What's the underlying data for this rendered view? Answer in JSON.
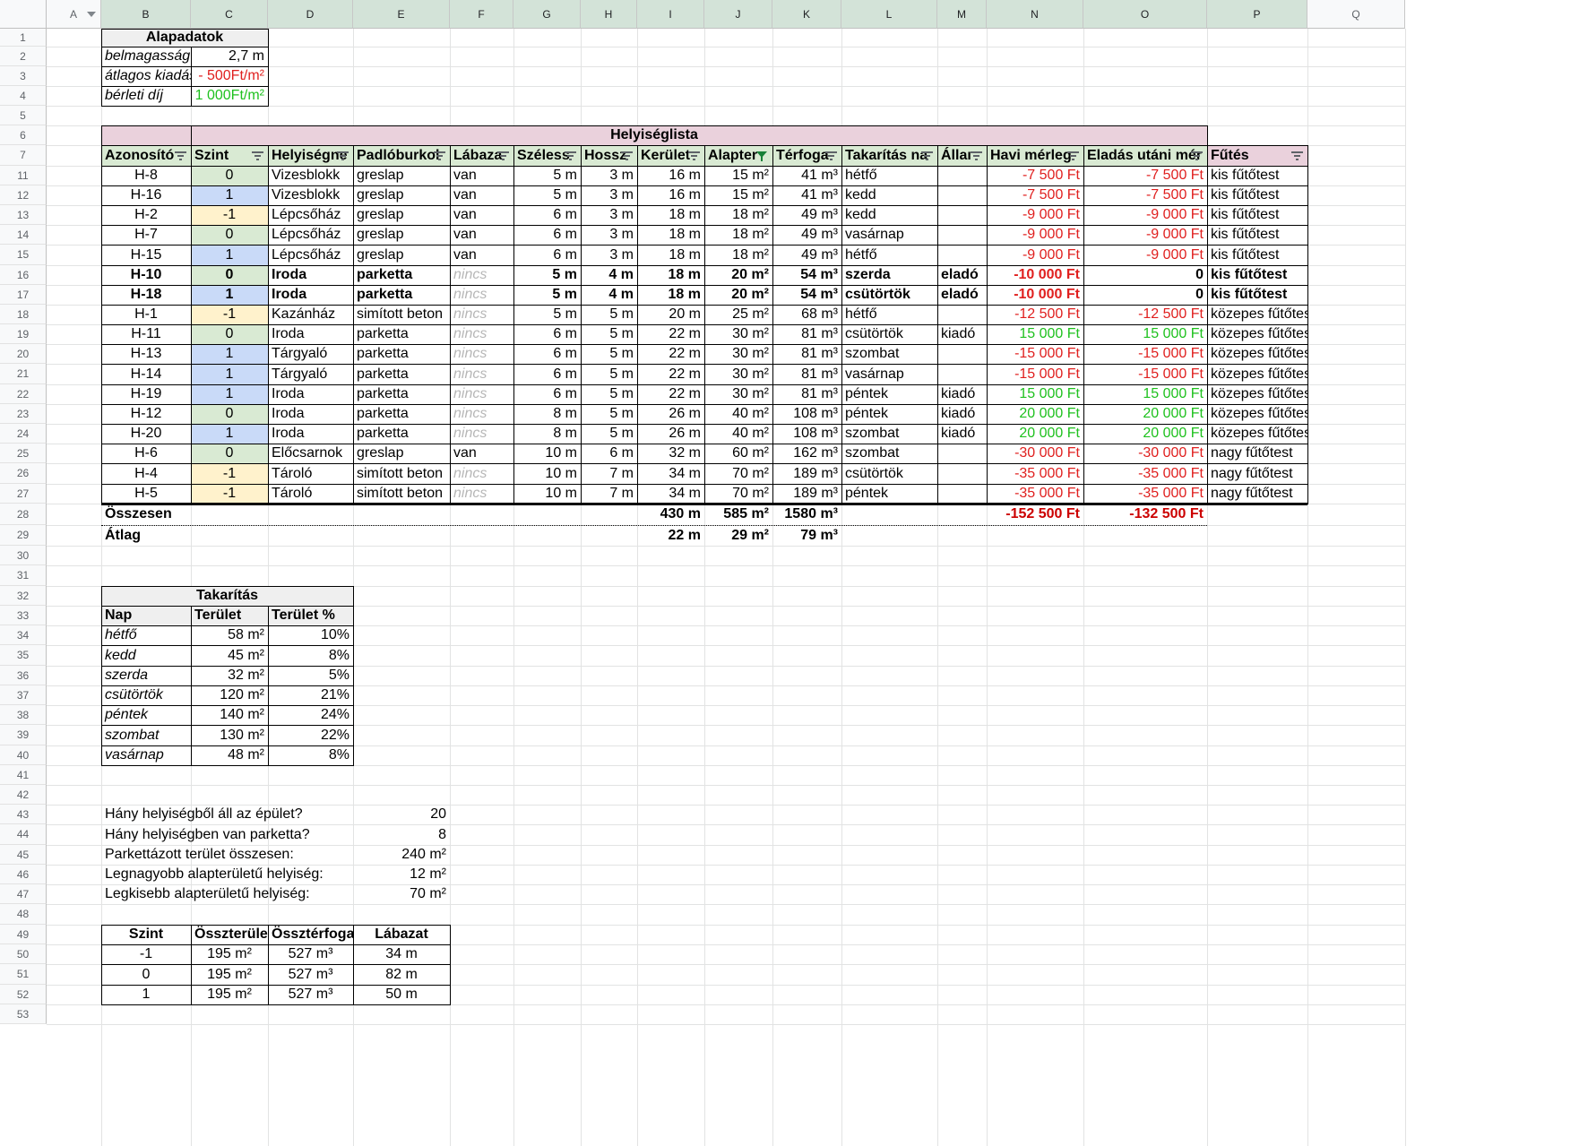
{
  "columns": [
    "A",
    "B",
    "C",
    "D",
    "E",
    "F",
    "G",
    "H",
    "I",
    "J",
    "K",
    "L",
    "M",
    "N",
    "O",
    "P",
    "Q"
  ],
  "rows": [
    1,
    2,
    3,
    4,
    5,
    6,
    7,
    11,
    12,
    13,
    14,
    15,
    16,
    17,
    18,
    19,
    20,
    21,
    22,
    23,
    24,
    25,
    26,
    27,
    28,
    29,
    30,
    31,
    32,
    33,
    34,
    35,
    36,
    37,
    38,
    39,
    40,
    41,
    42,
    43,
    44,
    45,
    46,
    47,
    48,
    49,
    50,
    51,
    52,
    53
  ],
  "alap": {
    "title": "Alapadatok",
    "rows": [
      {
        "label": "belmagasság",
        "value": "2,7 m"
      },
      {
        "label": "átlagos kiadás",
        "value": "- 500Ft/m²"
      },
      {
        "label": "bérleti díj",
        "value": "1 000Ft/m²"
      }
    ]
  },
  "helyiseg": {
    "title": "Helyiséglista",
    "headers": [
      "Azonosító",
      "Szint",
      "Helyiségne",
      "Padlóburkol",
      "Lábaza",
      "Széless",
      "Hossz",
      "Kerület",
      "Alapter",
      "Térfoga",
      "Takarítás na",
      "Állaı",
      "Havi mérleg",
      "Eladás utáni mér",
      "Fűtés"
    ],
    "rows": [
      [
        "H-8",
        "0",
        "Vizesblokk",
        "greslap",
        "van",
        "5 m",
        "3 m",
        "16 m",
        "15 m²",
        "41 m³",
        "hétfő",
        "",
        "-7 500 Ft",
        "-7 500 Ft",
        "kis fűtőtest"
      ],
      [
        "H-16",
        "1",
        "Vizesblokk",
        "greslap",
        "van",
        "5 m",
        "3 m",
        "16 m",
        "15 m²",
        "41 m³",
        "kedd",
        "",
        "-7 500 Ft",
        "-7 500 Ft",
        "kis fűtőtest"
      ],
      [
        "H-2",
        "-1",
        "Lépcsőház",
        "greslap",
        "van",
        "6 m",
        "3 m",
        "18 m",
        "18 m²",
        "49 m³",
        "kedd",
        "",
        "-9 000 Ft",
        "-9 000 Ft",
        "kis fűtőtest"
      ],
      [
        "H-7",
        "0",
        "Lépcsőház",
        "greslap",
        "van",
        "6 m",
        "3 m",
        "18 m",
        "18 m²",
        "49 m³",
        "vasárnap",
        "",
        "-9 000 Ft",
        "-9 000 Ft",
        "kis fűtőtest"
      ],
      [
        "H-15",
        "1",
        "Lépcsőház",
        "greslap",
        "van",
        "6 m",
        "3 m",
        "18 m",
        "18 m²",
        "49 m³",
        "hétfő",
        "",
        "-9 000 Ft",
        "-9 000 Ft",
        "kis fűtőtest"
      ],
      [
        "H-10",
        "0",
        "Iroda",
        "parketta",
        "nincs",
        "5 m",
        "4 m",
        "18 m",
        "20 m²",
        "54 m³",
        "szerda",
        "eladó",
        "-10 000 Ft",
        "0",
        "kis fűtőtest"
      ],
      [
        "H-18",
        "1",
        "Iroda",
        "parketta",
        "nincs",
        "5 m",
        "4 m",
        "18 m",
        "20 m²",
        "54 m³",
        "csütörtök",
        "eladó",
        "-10 000 Ft",
        "0",
        "kis fűtőtest"
      ],
      [
        "H-1",
        "-1",
        "Kazánház",
        "simított beton",
        "nincs",
        "5 m",
        "5 m",
        "20 m",
        "25 m²",
        "68 m³",
        "hétfő",
        "",
        "-12 500 Ft",
        "-12 500 Ft",
        "közepes fűtőtest"
      ],
      [
        "H-11",
        "0",
        "Iroda",
        "parketta",
        "nincs",
        "6 m",
        "5 m",
        "22 m",
        "30 m²",
        "81 m³",
        "csütörtök",
        "kiadó",
        "15 000 Ft",
        "15 000 Ft",
        "közepes fűtőtest"
      ],
      [
        "H-13",
        "1",
        "Tárgyaló",
        "parketta",
        "nincs",
        "6 m",
        "5 m",
        "22 m",
        "30 m²",
        "81 m³",
        "szombat",
        "",
        "-15 000 Ft",
        "-15 000 Ft",
        "közepes fűtőtest"
      ],
      [
        "H-14",
        "1",
        "Tárgyaló",
        "parketta",
        "nincs",
        "6 m",
        "5 m",
        "22 m",
        "30 m²",
        "81 m³",
        "vasárnap",
        "",
        "-15 000 Ft",
        "-15 000 Ft",
        "közepes fűtőtest"
      ],
      [
        "H-19",
        "1",
        "Iroda",
        "parketta",
        "nincs",
        "6 m",
        "5 m",
        "22 m",
        "30 m²",
        "81 m³",
        "péntek",
        "kiadó",
        "15 000 Ft",
        "15 000 Ft",
        "közepes fűtőtest"
      ],
      [
        "H-12",
        "0",
        "Iroda",
        "parketta",
        "nincs",
        "8 m",
        "5 m",
        "26 m",
        "40 m²",
        "108 m³",
        "péntek",
        "kiadó",
        "20 000 Ft",
        "20 000 Ft",
        "közepes fűtőtest"
      ],
      [
        "H-20",
        "1",
        "Iroda",
        "parketta",
        "nincs",
        "8 m",
        "5 m",
        "26 m",
        "40 m²",
        "108 m³",
        "szombat",
        "kiadó",
        "20 000 Ft",
        "20 000 Ft",
        "közepes fűtőtest"
      ],
      [
        "H-6",
        "0",
        "Előcsarnok",
        "greslap",
        "van",
        "10 m",
        "6 m",
        "32 m",
        "60 m²",
        "162 m³",
        "szombat",
        "",
        "-30 000 Ft",
        "-30 000 Ft",
        "nagy fűtőtest"
      ],
      [
        "H-4",
        "-1",
        "Tároló",
        "simított beton",
        "nincs",
        "10 m",
        "7 m",
        "34 m",
        "70 m²",
        "189 m³",
        "csütörtök",
        "",
        "-35 000 Ft",
        "-35 000 Ft",
        "nagy fűtőtest"
      ],
      [
        "H-5",
        "-1",
        "Tároló",
        "simított beton",
        "nincs",
        "10 m",
        "7 m",
        "34 m",
        "70 m²",
        "189 m³",
        "péntek",
        "",
        "-35 000 Ft",
        "-35 000 Ft",
        "nagy fűtőtest"
      ]
    ],
    "total": {
      "label": "Összesen",
      "kerulet": "430 m",
      "alapterulet": "585 m²",
      "terfogat": "1580 m³",
      "havi": "-152 500 Ft",
      "eladas": "-132 500 Ft"
    },
    "atlag": {
      "label": "Átlag",
      "kerulet": "22 m",
      "alapterulet": "29 m²",
      "terfogat": "79 m³"
    }
  },
  "takaritas": {
    "title": "Takarítás",
    "headers": [
      "Nap",
      "Terület",
      "Terület %"
    ],
    "rows": [
      [
        "hétfő",
        "58 m²",
        "10%"
      ],
      [
        "kedd",
        "45 m²",
        "8%"
      ],
      [
        "szerda",
        "32 m²",
        "5%"
      ],
      [
        "csütörtök",
        "120 m²",
        "21%"
      ],
      [
        "péntek",
        "140 m²",
        "24%"
      ],
      [
        "szombat",
        "130 m²",
        "22%"
      ],
      [
        "vasárnap",
        "48 m²",
        "8%"
      ]
    ]
  },
  "questions": [
    {
      "q": "Hány helyiségből áll az épület?",
      "a": "20"
    },
    {
      "q": "Hány helyiségben van parketta?",
      "a": "8"
    },
    {
      "q": "Parkettázott terület összesen:",
      "a": "240 m²"
    },
    {
      "q": "Legnagyobb alapterületű helyiség:",
      "a": "12 m²"
    },
    {
      "q": "Legkisebb alapterületű helyiség:",
      "a": "70 m²"
    }
  ],
  "szint": {
    "headers": [
      "Szint",
      "Összterület",
      "Össztérfogat",
      "Lábazat"
    ],
    "rows": [
      [
        "-1",
        "195 m²",
        "527 m³",
        "34 m"
      ],
      [
        "0",
        "195 m²",
        "527 m³",
        "82 m"
      ],
      [
        "1",
        "195 m²",
        "527 m³",
        "50 m"
      ]
    ]
  },
  "colors": {
    "pink_header": "#ead1dc",
    "green_header": "#d9ead3",
    "lvl_0": "#d9ead3",
    "lvl_1": "#c9daf8",
    "lvl_m1": "#fff2cc",
    "negative": "#e0201f",
    "positive": "#1ec11e",
    "total_neg": "#cc0000",
    "grid": "#e2e3e3",
    "header_bg": "#f8f9fa"
  }
}
